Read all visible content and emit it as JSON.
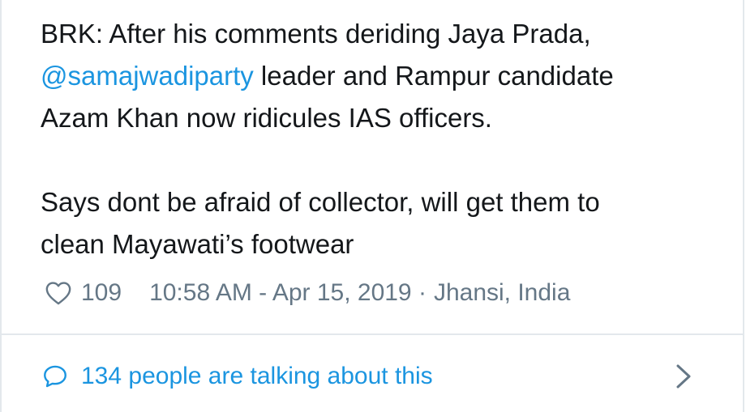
{
  "tweet": {
    "line1_prefix": "BRK: After his comments deriding Jaya Prada,",
    "mention": "@samajwadiparty",
    "line2_suffix": " leader and Rampur candidate",
    "line3": "Azam Khan now ridicules IAS officers.",
    "paragraph2_line1": "Says dont be afraid of collector, will get them to",
    "paragraph2_line2": "clean Mayawati’s footwear"
  },
  "meta": {
    "likes": "109",
    "time": "10:58 AM - Apr 15, 2019 ·",
    "location": "Jhansi, India"
  },
  "conversation": {
    "label": "134 people are talking about this"
  },
  "colors": {
    "link": "#1b95e0",
    "text": "#14171a",
    "muted": "#657786",
    "border": "#e3e8ec"
  },
  "icons": {
    "like": "heart-icon",
    "conversation": "speech-bubble-icon",
    "more": "chevron-right-icon"
  }
}
